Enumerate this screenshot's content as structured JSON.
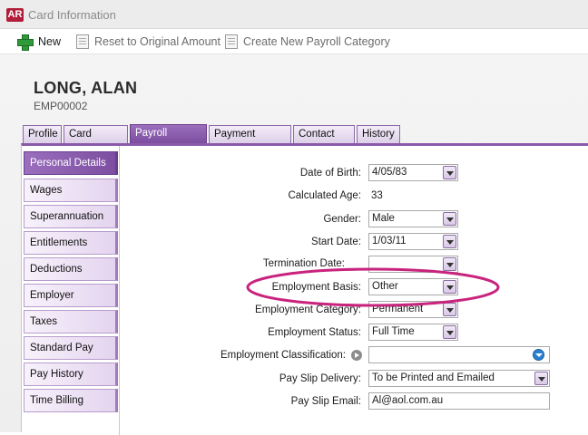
{
  "window": {
    "logo": "AR",
    "title": "Card Information"
  },
  "toolbar": {
    "new_label": "New",
    "reset_label": "Reset to Original Amount",
    "create_category_label": "Create New Payroll Category"
  },
  "employee": {
    "name": "LONG, ALAN",
    "id": "EMP00002"
  },
  "tabs": [
    "Profile",
    "Card Details",
    "Payroll Details",
    "Payment Details",
    "Contact Log",
    "History"
  ],
  "active_tab": "Payroll Details",
  "sidebar": {
    "items": [
      "Personal Details",
      "Wages",
      "Superannuation",
      "Entitlements",
      "Deductions",
      "Employer Expenses",
      "Taxes",
      "Standard Pay",
      "Pay History",
      "Time Billing"
    ],
    "active": "Personal Details"
  },
  "form": {
    "date_of_birth": {
      "label": "Date of Birth:",
      "value": "4/05/83"
    },
    "calculated_age": {
      "label": "Calculated Age:",
      "value": "33"
    },
    "gender": {
      "label": "Gender:",
      "value": "Male"
    },
    "start_date": {
      "label": "Start Date:",
      "value": "1/03/11"
    },
    "termination_date": {
      "label": "Termination Date:",
      "value": ""
    },
    "employment_basis": {
      "label": "Employment Basis:",
      "value": "Other"
    },
    "employment_category": {
      "label": "Employment Category:",
      "value": "Permanent"
    },
    "employment_status": {
      "label": "Employment Status:",
      "value": "Full Time"
    },
    "employment_classification": {
      "label": "Employment Classification:",
      "value": ""
    },
    "pay_slip_delivery": {
      "label": "Pay Slip Delivery:",
      "value": "To be Printed and Emailed"
    },
    "pay_slip_email": {
      "label": "Pay Slip Email:",
      "value": "Al@aol.com.au"
    }
  },
  "colors": {
    "accent": "#8a5aaa",
    "highlight_ring": "#c8237d",
    "logo": "#b21d3a"
  }
}
